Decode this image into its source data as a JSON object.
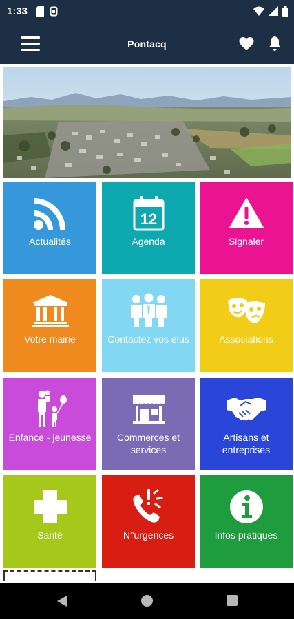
{
  "status": {
    "time": "1:33"
  },
  "app_bar": {
    "title": "Pontacq"
  },
  "tiles": [
    {
      "label": "Actualités",
      "color": "#3498db",
      "icon": "rss-icon"
    },
    {
      "label": "Agenda",
      "color": "#0da8b0",
      "icon": "calendar-icon",
      "day": "12"
    },
    {
      "label": "Signaler",
      "color": "#ec1392",
      "icon": "warning-icon"
    },
    {
      "label": "Votre mairie",
      "color": "#ef8a1f",
      "icon": "town-hall-icon"
    },
    {
      "label": "Contactez vos élus",
      "color": "#82d8f2",
      "icon": "people-icon"
    },
    {
      "label": "Associations",
      "color": "#f2cd18",
      "icon": "masks-icon"
    },
    {
      "label": "Enfance - jeunesse",
      "color": "#c84bd9",
      "icon": "family-icon"
    },
    {
      "label": "Commerces et services",
      "color": "#7b6bb5",
      "icon": "shop-icon"
    },
    {
      "label": "Artisans et entreprises",
      "color": "#2a46d8",
      "icon": "handshake-icon"
    },
    {
      "label": "Santé",
      "color": "#a6c81a",
      "icon": "health-cross-icon"
    },
    {
      "label": "N°urgences",
      "color": "#d81e12",
      "icon": "emergency-phone-icon"
    },
    {
      "label": "Infos pratiques",
      "color": "#1f9d3e",
      "icon": "info-icon"
    }
  ]
}
